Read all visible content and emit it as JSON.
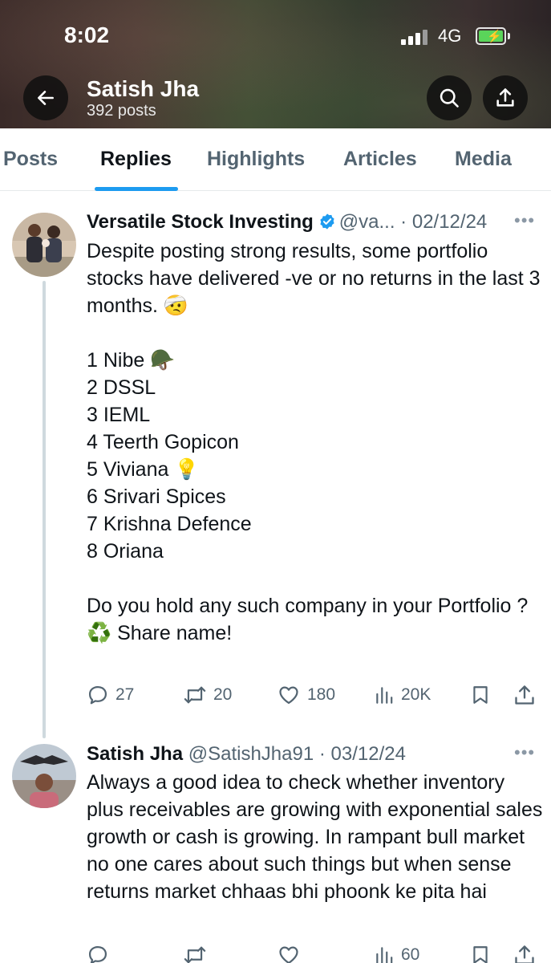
{
  "status_bar": {
    "time": "8:02",
    "network": "4G"
  },
  "profile": {
    "name": "Satish Jha",
    "posts_count": "392 posts"
  },
  "tabs": [
    {
      "label": "Posts"
    },
    {
      "label": "Replies"
    },
    {
      "label": "Highlights"
    },
    {
      "label": "Articles"
    },
    {
      "label": "Media"
    }
  ],
  "accent_color": "#1d9bf0",
  "tweets": [
    {
      "name": "Versatile Stock Investing",
      "handle_date": "@va... · 02/12/24",
      "body": "Despite posting strong results, some portfolio stocks have delivered -ve or no returns in the last 3 months. 🤕\n\n1 Nibe 🪖\n2 DSSL\n3 IEML\n4 Teerth Gopicon\n5 Viviana 💡\n6 Srivari Spices\n7 Krishna Defence\n8 Oriana\n\nDo you hold any such company in your Portfolio ?\n♻️ Share name!",
      "replies": "27",
      "reposts": "20",
      "likes": "180",
      "views": "20K"
    },
    {
      "name": "Satish Jha",
      "handle_date": "@SatishJha91 · 03/12/24",
      "body": "Always a good idea to check whether inventory plus receivables are growing with exponential sales growth or cash is growing. In rampant bull market no one cares about such things but when sense returns market chhaas bhi phoonk ke pita hai",
      "views": "60"
    }
  ]
}
